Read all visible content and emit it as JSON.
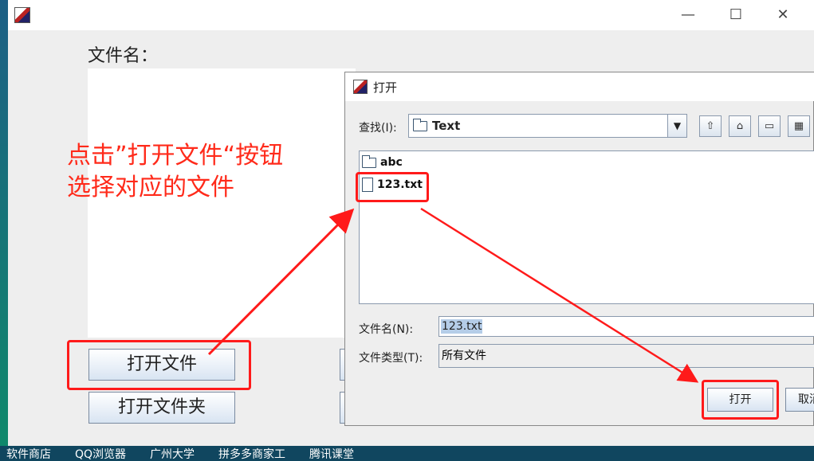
{
  "taskbar": {
    "items": [
      "软件商店",
      "QQ浏览器",
      "广州大学",
      "拼多多商家工",
      "腾讯课堂"
    ]
  },
  "main_window": {
    "minimize": "—",
    "maximize": "☐",
    "close": "✕",
    "filename_label": "文件名：",
    "annotation_line1": "点击”打开文件“按钮",
    "annotation_line2": "选择对应的文件",
    "open_file_button": "打开文件",
    "open_folder_button": "打开文件夹"
  },
  "dialog": {
    "title": "打开",
    "look_in_label": "查找(I):",
    "look_in_value": "Text",
    "files": [
      {
        "name": "abc",
        "icon": "folder-icon"
      },
      {
        "name": "123.txt",
        "icon": "file-icon"
      }
    ],
    "filename_label": "文件名(N):",
    "filename_value": "123.txt",
    "filetype_label": "文件类型(T):",
    "filetype_value": "所有文件",
    "open_button": "打开",
    "cancel_button": "取消"
  },
  "colors": {
    "annotation": "#ff2a1a",
    "highlight_box": "#ff1a1a"
  }
}
